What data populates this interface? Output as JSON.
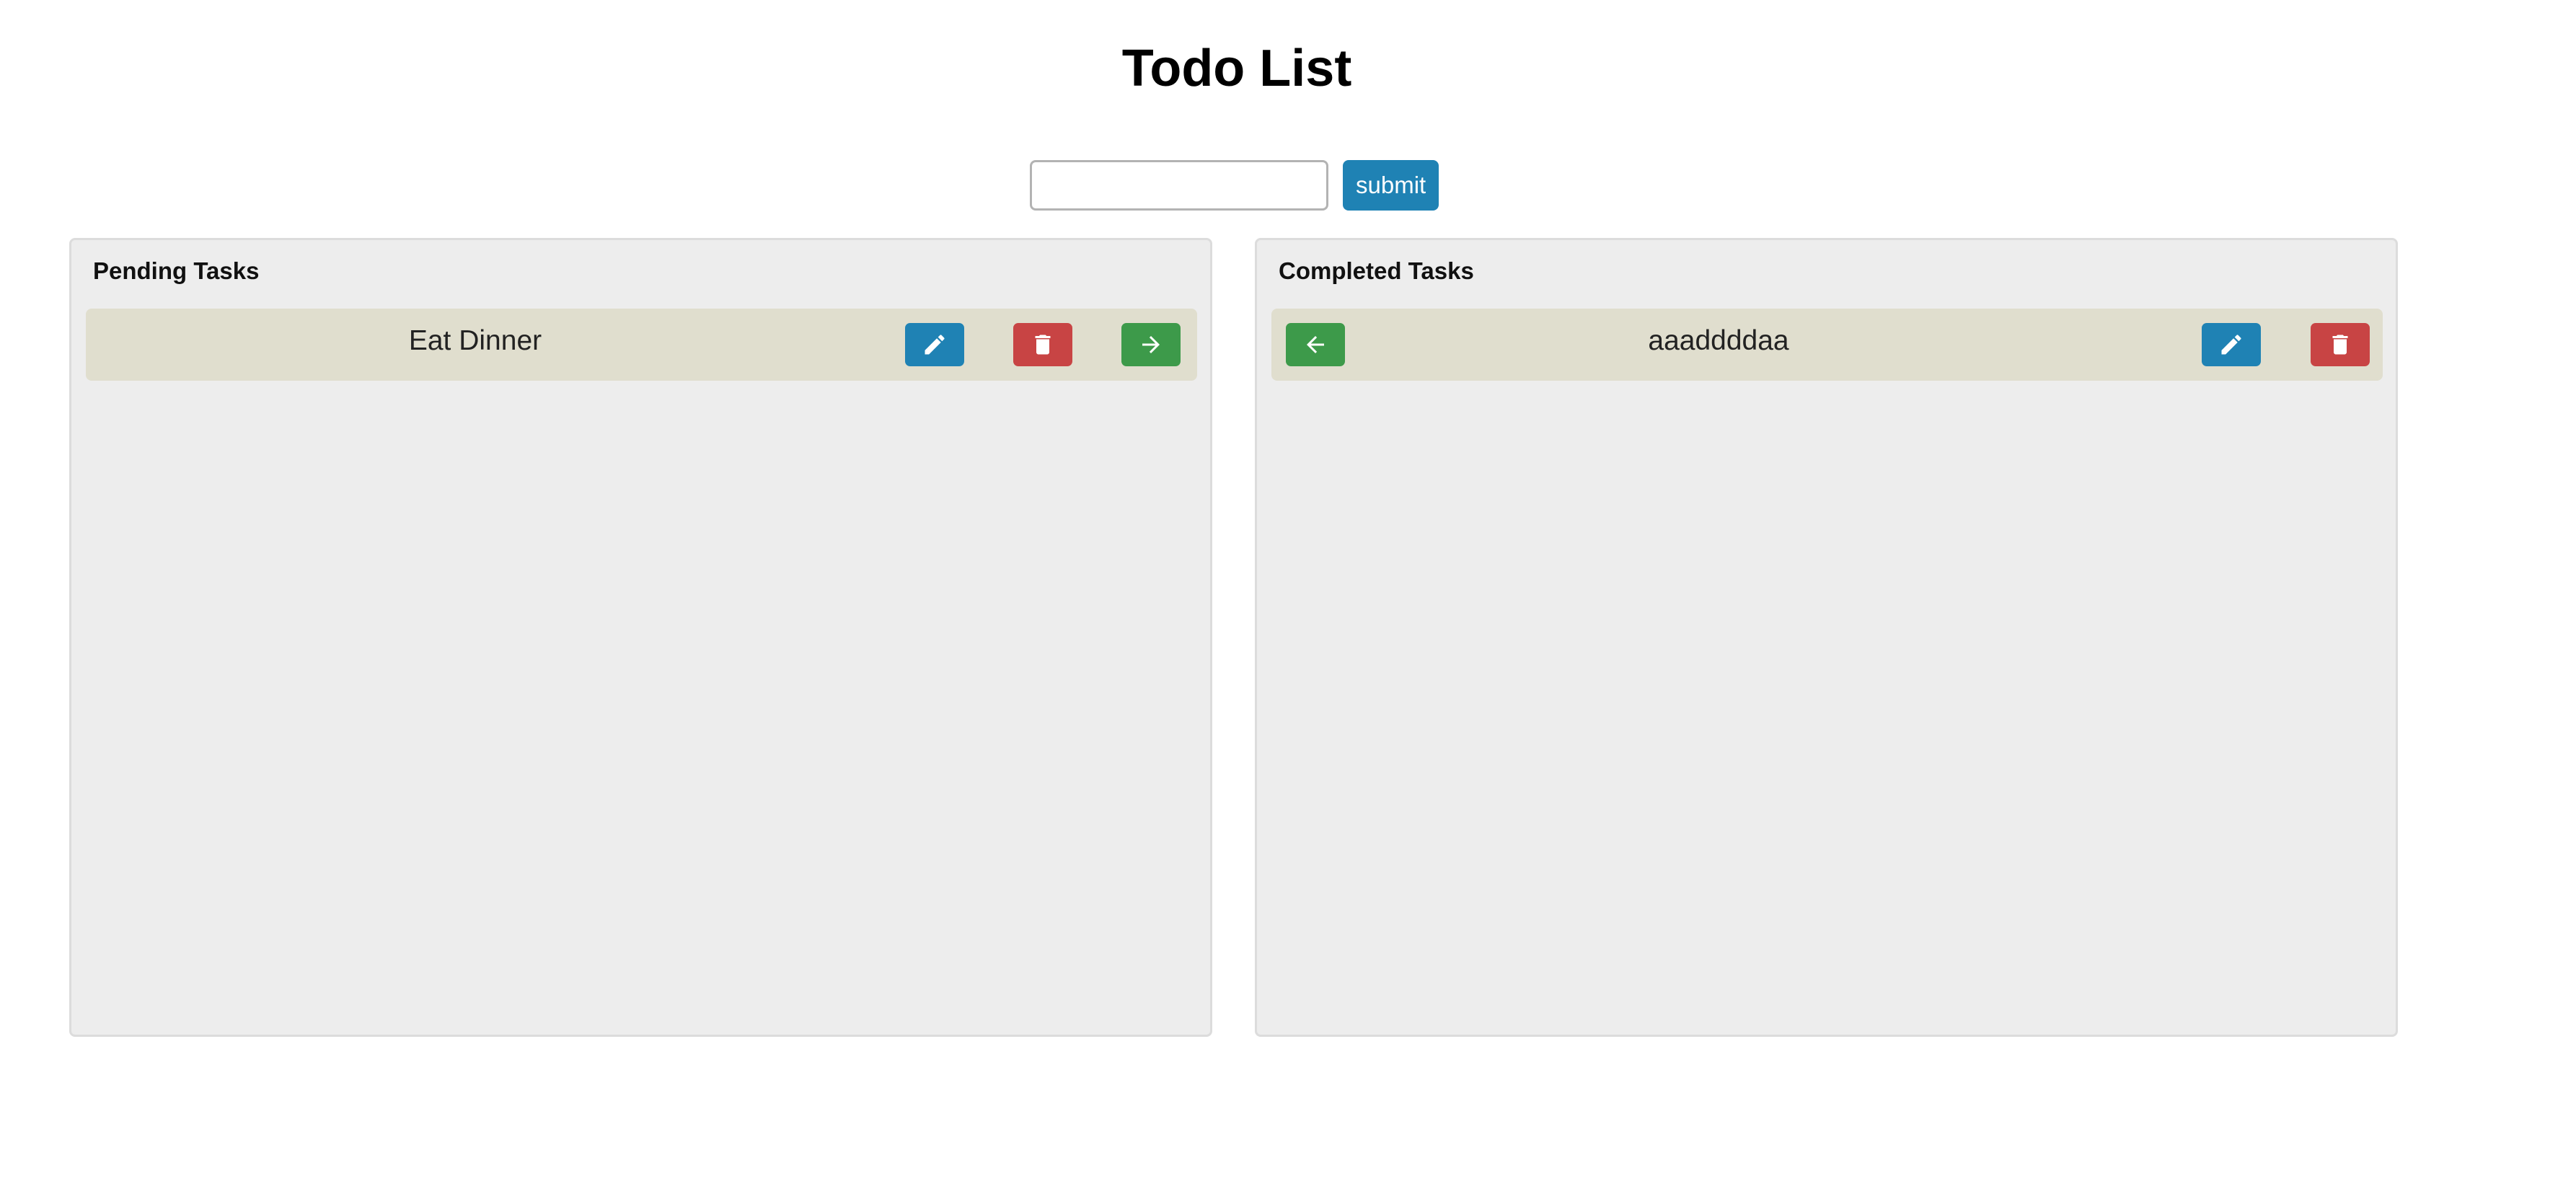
{
  "header": {
    "title": "Todo List"
  },
  "form": {
    "input_value": "",
    "input_placeholder": "",
    "submit_label": "submit"
  },
  "pending": {
    "title": "Pending Tasks",
    "tasks": [
      {
        "text": "Eat Dinner"
      }
    ]
  },
  "completed": {
    "title": "Completed Tasks",
    "tasks": [
      {
        "text": "aaaddddaa"
      }
    ]
  },
  "colors": {
    "primary": "#1f82b4",
    "danger": "#c84444",
    "success": "#3d9a4a",
    "panel_bg": "#ededed",
    "task_bg": "#e0dece"
  },
  "icons": {
    "edit": "pencil-icon",
    "delete": "trash-icon",
    "complete": "arrow-right-icon",
    "undo": "arrow-left-icon"
  }
}
